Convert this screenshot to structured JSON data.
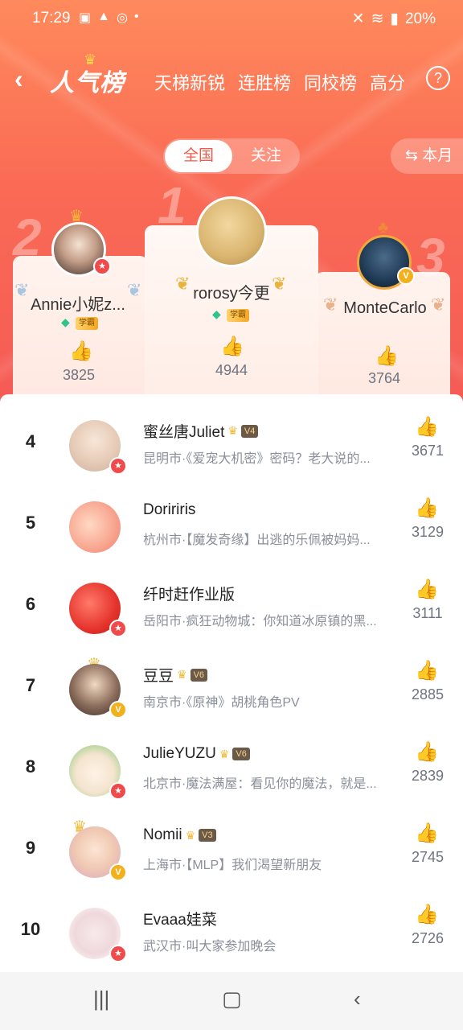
{
  "status": {
    "time": "17:29",
    "battery": "20%"
  },
  "header": {
    "title": "人气榜",
    "tabs": [
      "天梯新锐",
      "连胜榜",
      "同校榜",
      "高分"
    ],
    "help": "?"
  },
  "scope": {
    "active": "全国",
    "inactive": "关注"
  },
  "period": {
    "label": "本月"
  },
  "podium": [
    {
      "rank": "1",
      "name": "rorosy今更",
      "tag": "学霸",
      "likes": "4944"
    },
    {
      "rank": "2",
      "name": "Annie小妮z...",
      "tag": "学霸",
      "likes": "3825"
    },
    {
      "rank": "3",
      "name": "MonteCarlo",
      "likes": "3764"
    }
  ],
  "list": [
    {
      "rank": "4",
      "name": "蜜丝唐Juliet",
      "level": "V4",
      "desc": "昆明市·《爱宠大机密》密码？老大说的...",
      "likes": "3671"
    },
    {
      "rank": "5",
      "name": "Doririris",
      "level": "",
      "desc": "杭州市·【魔发奇缘】出逃的乐佩被妈妈...",
      "likes": "3129"
    },
    {
      "rank": "6",
      "name": "纤时赶作业版",
      "level": "",
      "desc": "岳阳市·疯狂动物城：你知道冰原镇的黑...",
      "likes": "3111"
    },
    {
      "rank": "7",
      "name": "豆豆",
      "level": "V6",
      "desc": "南京市·《原神》胡桃角色PV",
      "likes": "2885"
    },
    {
      "rank": "8",
      "name": "JulieYUZU",
      "level": "V6",
      "desc": "北京市·魔法满屋：看见你的魔法，就是...",
      "likes": "2839"
    },
    {
      "rank": "9",
      "name": "Nomii",
      "level": "V3",
      "desc": "上海市·【MLP】我们渴望新朋友",
      "likes": "2745"
    },
    {
      "rank": "10",
      "name": "Evaaa娃菜",
      "level": "",
      "desc": "武汉市·叫大家参加晚会",
      "likes": "2726"
    }
  ],
  "icons": {
    "back": "chevron-left-icon",
    "like": "thumbs-up-icon",
    "swap": "swap-icon"
  },
  "colors": {
    "accent": "#f25a4a",
    "gold": "#f2b01c",
    "gem": "#2ec48b"
  }
}
